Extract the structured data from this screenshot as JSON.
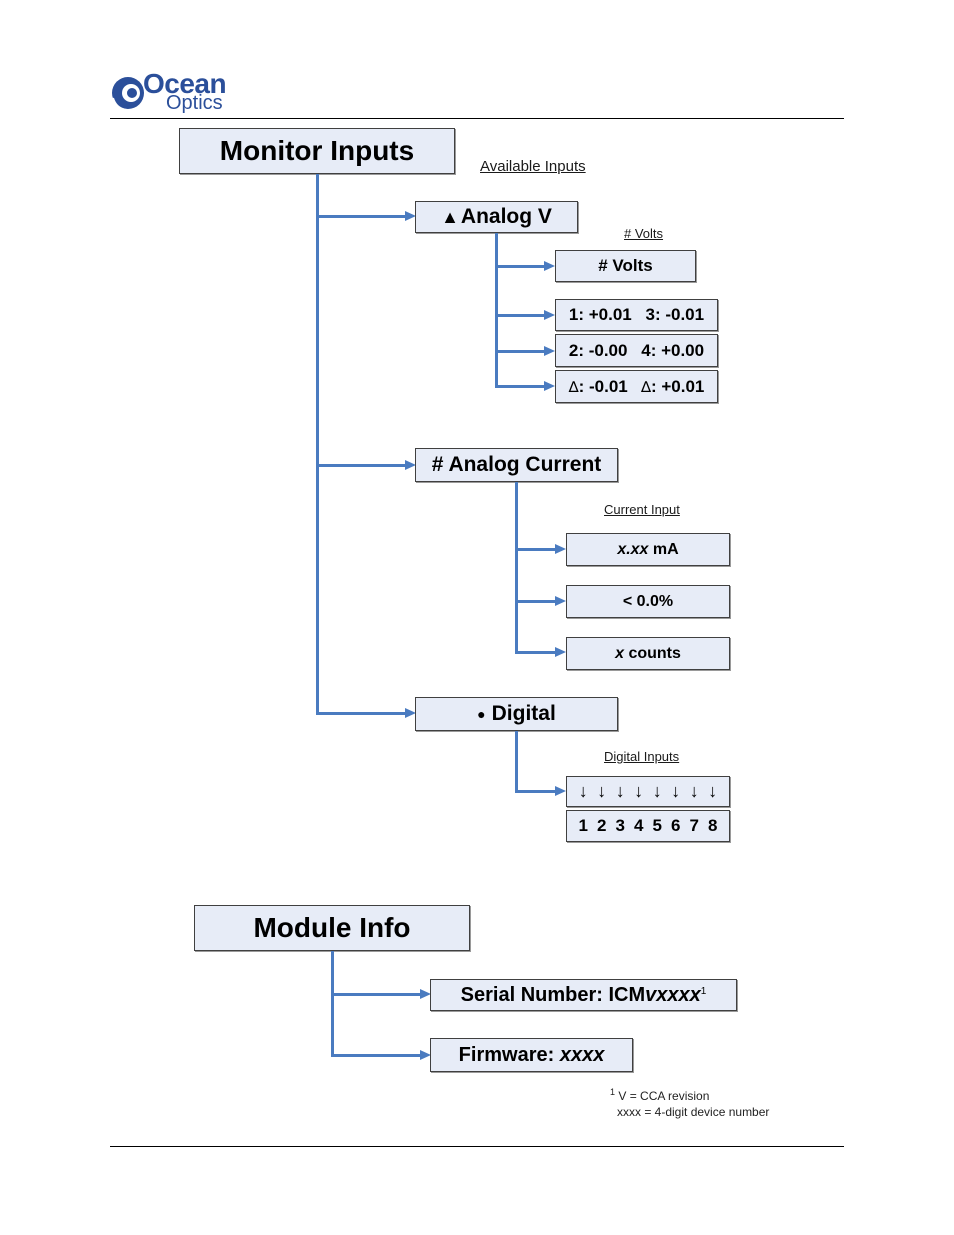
{
  "header": {
    "logo": {
      "line1": "Ocean",
      "line2": "Optics",
      "icon": "ocean-optics-swirl-logo"
    },
    "colors": {
      "box_fill": "#e7ecf7",
      "connector": "#4a7bc0",
      "logo": "#2b4f9a"
    }
  },
  "monitor_inputs": {
    "title": "Monitor Inputs",
    "available_label": "Available Inputs",
    "analog_v": {
      "icon": "triangle-up-icon",
      "icon_glyph": "▲",
      "title": "Analog V",
      "sub_label": "# Volts",
      "items": [
        {
          "text": "# Volts"
        },
        {
          "left": "1: +0.01",
          "right": "3: -0.01"
        },
        {
          "left": "2: -0.00",
          "right": "4: +0.00"
        },
        {
          "left_sym": "∆",
          "left": ": -0.01",
          "right_sym": "∆",
          "right": ": +0.01"
        }
      ]
    },
    "analog_current": {
      "title": "# Analog Current",
      "sub_label": "Current Input",
      "items": [
        {
          "italic": "x.xx",
          "rest": " mA"
        },
        {
          "italic": "",
          "rest": "< 0.0%"
        },
        {
          "italic": "x",
          "rest": " counts"
        }
      ]
    },
    "digital": {
      "icon": "bullet-icon",
      "icon_glyph": "●",
      "title": "Digital",
      "sub_label": "Digital Inputs",
      "arrow_glyph": "↓",
      "channels": [
        "1",
        "2",
        "3",
        "4",
        "5",
        "6",
        "7",
        "8"
      ]
    }
  },
  "module_info": {
    "title": "Module Info",
    "serial": {
      "label": "Serial Number: ICM",
      "italic": "vxxxx",
      "sup": "1"
    },
    "firmware": {
      "label": "Firmware: ",
      "italic": "xxxx"
    },
    "footnote": {
      "mark": "1",
      "line1": "V = CCA revision",
      "line2": "xxxx = 4-digit device number"
    }
  }
}
